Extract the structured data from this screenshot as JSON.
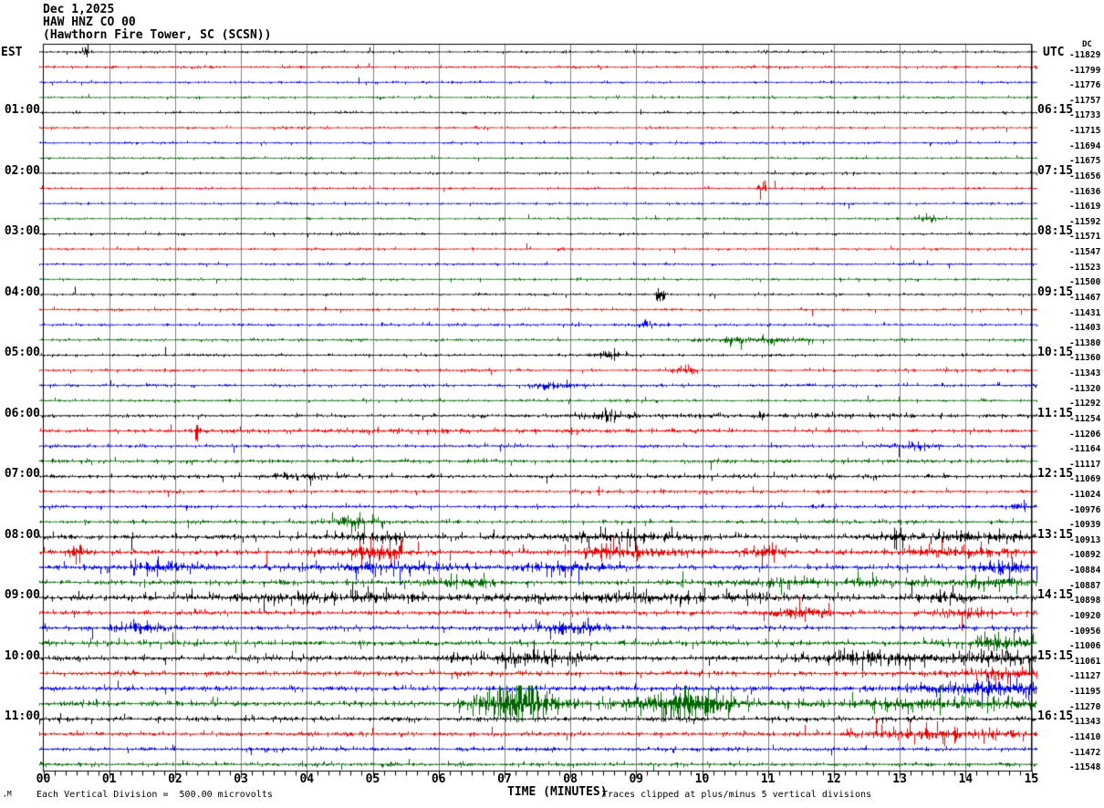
{
  "header": {
    "date": "Dec 1,2025",
    "station": "HAW HNZ CO 00",
    "location": "(Hawthorn Fire Tower, SC (SCSN))"
  },
  "axes": {
    "left_label": "EST",
    "right_label": "UTC",
    "dc_label": "DC",
    "x_label": "TIME (MINUTES)",
    "x_ticks": [
      "00",
      "01",
      "02",
      "03",
      "04",
      "05",
      "06",
      "07",
      "08",
      "09",
      "10",
      "11",
      "12",
      "13",
      "14",
      "15"
    ]
  },
  "footer": {
    "scale_note": "Each Vertical Division =  500.00 microvolts",
    "clip_note": "Traces clipped at plus/minus 5 vertical divisions",
    "corner_mark": ",M"
  },
  "chart_data": {
    "type": "line",
    "title": "Helicorder record HAW HNZ CO 00 (Hawthorn Fire Tower, SC (SCSN)), Dec 1,2025",
    "x_axis": {
      "label": "TIME (MINUTES)",
      "range": [
        0,
        15
      ],
      "minor_ticks_per_minute": 6
    },
    "minutes_per_line": 15,
    "microvolts_per_division": 500.0,
    "clip_divisions": 5,
    "colors": {
      "cycle": [
        "#000000",
        "#ee0000",
        "#0000ee",
        "#006600"
      ],
      "grid": "#808080",
      "frame": "#000000"
    },
    "legend": {
      "left_column": "EST local start times",
      "right_column": "UTC start times",
      "dc_column": "DC offset counts"
    },
    "traces": [
      {
        "dc": "-11829",
        "base": 0.7,
        "bursts": [
          [
            0.65,
            0.05,
            4
          ]
        ]
      },
      {
        "dc": "-11799",
        "base": 0.8,
        "bursts": []
      },
      {
        "dc": "-11776",
        "base": 0.7,
        "bursts": []
      },
      {
        "dc": "-11757",
        "base": 0.7,
        "bursts": []
      },
      {
        "est": "01:00",
        "utc": "06:15",
        "dc": "-11733",
        "base": 0.7,
        "bursts": []
      },
      {
        "dc": "-11715",
        "base": 0.7,
        "bursts": []
      },
      {
        "dc": "-11694",
        "base": 0.7,
        "bursts": []
      },
      {
        "dc": "-11675",
        "base": 0.7,
        "bursts": []
      },
      {
        "est": "02:00",
        "utc": "07:15",
        "dc": "-11656",
        "base": 0.7,
        "bursts": []
      },
      {
        "dc": "-11636",
        "base": 0.7,
        "bursts": [
          [
            10.9,
            0.05,
            5
          ]
        ]
      },
      {
        "dc": "-11619",
        "base": 0.7,
        "bursts": []
      },
      {
        "dc": "-11592",
        "base": 0.7,
        "bursts": [
          [
            13.4,
            0.15,
            2
          ]
        ]
      },
      {
        "est": "03:00",
        "utc": "08:15",
        "dc": "-11571",
        "base": 0.7,
        "bursts": []
      },
      {
        "dc": "-11547",
        "base": 0.7,
        "bursts": []
      },
      {
        "dc": "-11523",
        "base": 0.7,
        "bursts": []
      },
      {
        "dc": "-11500",
        "base": 0.7,
        "bursts": []
      },
      {
        "est": "04:00",
        "utc": "09:15",
        "dc": "-11467",
        "base": 0.7,
        "bursts": [
          [
            9.35,
            0.05,
            6
          ]
        ]
      },
      {
        "dc": "-11431",
        "base": 0.8,
        "bursts": []
      },
      {
        "dc": "-11403",
        "base": 0.8,
        "bursts": [
          [
            9.1,
            0.12,
            2.5
          ]
        ]
      },
      {
        "dc": "-11380",
        "base": 0.8,
        "bursts": [
          [
            10.8,
            0.5,
            2.2
          ]
        ]
      },
      {
        "est": "05:00",
        "utc": "10:15",
        "dc": "-11360",
        "base": 0.8,
        "bursts": [
          [
            8.6,
            0.15,
            3
          ]
        ]
      },
      {
        "dc": "-11343",
        "base": 0.8,
        "bursts": [
          [
            9.7,
            0.12,
            2.5
          ]
        ]
      },
      {
        "dc": "-11320",
        "base": 0.9,
        "bursts": [
          [
            7.7,
            0.3,
            2.5
          ]
        ]
      },
      {
        "dc": "-11292",
        "base": 0.8,
        "bursts": []
      },
      {
        "est": "06:00",
        "utc": "11:15",
        "dc": "-11254",
        "base": 1.0,
        "bursts": [
          [
            8.5,
            0.2,
            3
          ],
          [
            11.5,
            2.5,
            0.7
          ]
        ]
      },
      {
        "dc": "-11206",
        "base": 1.0,
        "bursts": [
          [
            2.33,
            0.03,
            14
          ],
          [
            6.0,
            3.0,
            0.5
          ]
        ]
      },
      {
        "dc": "-11164",
        "base": 1.0,
        "bursts": [
          [
            13.2,
            0.3,
            2.5
          ]
        ]
      },
      {
        "dc": "-11117",
        "base": 1.2,
        "bursts": []
      },
      {
        "est": "07:00",
        "utc": "12:15",
        "dc": "-11069",
        "base": 1.2,
        "bursts": [
          [
            3.9,
            0.3,
            2.5
          ]
        ]
      },
      {
        "dc": "-11024",
        "base": 1.0,
        "bursts": []
      },
      {
        "dc": "-10976",
        "base": 1.0,
        "bursts": [
          [
            14.8,
            0.15,
            3
          ]
        ]
      },
      {
        "dc": "-10939",
        "base": 1.1,
        "bursts": [
          [
            4.7,
            0.3,
            3
          ]
        ]
      },
      {
        "est": "08:00",
        "utc": "13:15",
        "dc": "-10913",
        "base": 1.5,
        "bursts": [
          [
            5.0,
            0.3,
            3
          ],
          [
            8.7,
            0.8,
            2.5
          ],
          [
            13.0,
            0.15,
            4
          ],
          [
            14.2,
            0.6,
            3
          ]
        ]
      },
      {
        "dc": "-10892",
        "base": 1.5,
        "bursts": [
          [
            0.5,
            0.1,
            4
          ],
          [
            5.0,
            0.35,
            5
          ],
          [
            8.9,
            0.5,
            4
          ],
          [
            11.0,
            0.2,
            4
          ],
          [
            13.9,
            0.6,
            2.5
          ]
        ]
      },
      {
        "dc": "-10884",
        "base": 1.5,
        "bursts": [
          [
            1.8,
            0.5,
            3
          ],
          [
            5.3,
            1.0,
            2.2
          ],
          [
            8.0,
            0.35,
            3
          ],
          [
            14.6,
            0.3,
            3
          ]
        ]
      },
      {
        "dc": "-10887",
        "base": 1.4,
        "bursts": [
          [
            6.3,
            0.35,
            3
          ],
          [
            11.5,
            1.0,
            1.8
          ],
          [
            14.3,
            0.7,
            2.5
          ]
        ]
      },
      {
        "est": "09:00",
        "utc": "14:15",
        "dc": "-10898",
        "base": 1.7,
        "bursts": [
          [
            4.2,
            1.2,
            2.2
          ],
          [
            9.0,
            1.5,
            1.8
          ],
          [
            13.6,
            0.25,
            4
          ]
        ]
      },
      {
        "dc": "-10920",
        "base": 1.4,
        "bursts": [
          [
            11.5,
            0.4,
            3
          ],
          [
            14.0,
            0.3,
            2.5
          ]
        ]
      },
      {
        "dc": "-10956",
        "base": 1.4,
        "bursts": [
          [
            1.45,
            0.25,
            4
          ],
          [
            8.0,
            0.35,
            3.5
          ]
        ]
      },
      {
        "dc": "-11006",
        "base": 1.6,
        "bursts": [
          [
            14.6,
            0.4,
            4
          ]
        ]
      },
      {
        "est": "10:00",
        "utc": "15:15",
        "dc": "-11061",
        "base": 1.7,
        "bursts": [
          [
            7.3,
            0.7,
            3.5
          ],
          [
            12.5,
            0.5,
            3
          ],
          [
            14.2,
            0.8,
            3.5
          ]
        ]
      },
      {
        "dc": "-11127",
        "base": 1.4,
        "bursts": [
          [
            14.5,
            0.5,
            3.5
          ]
        ]
      },
      {
        "dc": "-11195",
        "base": 1.5,
        "bursts": [
          [
            14.3,
            0.7,
            4.5
          ]
        ]
      },
      {
        "dc": "-11270",
        "base": 1.6,
        "bursts": [
          [
            7.2,
            0.4,
            16
          ],
          [
            9.7,
            0.6,
            8
          ],
          [
            13.8,
            1.2,
            3
          ]
        ]
      },
      {
        "est": "11:00",
        "utc": "16:15",
        "dc": "-11343",
        "base": 1.4,
        "bursts": []
      },
      {
        "dc": "-11410",
        "base": 1.3,
        "bursts": [
          [
            13.6,
            0.8,
            3.5
          ]
        ]
      },
      {
        "dc": "-11472",
        "base": 1.2,
        "bursts": []
      },
      {
        "dc": "-11548",
        "base": 1.2,
        "bursts": []
      }
    ]
  }
}
